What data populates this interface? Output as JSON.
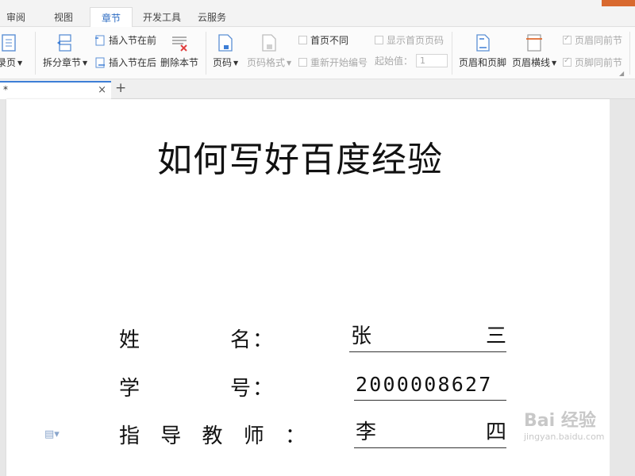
{
  "menubar": {
    "tabs": [
      "审阅",
      "视图",
      "章节",
      "开发工具",
      "云服务"
    ],
    "active_tab": "章节"
  },
  "ribbon": {
    "toc_page": "录页",
    "split_section": "拆分章节",
    "insert_before": "插入节在前",
    "insert_after": "插入节在后",
    "delete_section": "删除本节",
    "page_number": "页码",
    "page_number_format": "页码格式",
    "first_page_different": "首页不同",
    "restart_numbering": "重新开始编号",
    "show_first_page_number": "显示首页页码",
    "start_value_label": "起始值：",
    "start_value": "1",
    "header_footer": "页眉和页脚",
    "header_line": "页眉横线",
    "header_same_as_prev": "页眉同前节",
    "footer_same_as_prev": "页脚同前节"
  },
  "doc_tab": {
    "name": "*",
    "close": "×",
    "add": "+"
  },
  "document": {
    "title": "如何写好百度经验",
    "fields": [
      {
        "label": "姓　　　　名：",
        "value_left": "张",
        "value_right": "三"
      },
      {
        "label": "学　　　　号：",
        "value_left": "2000008627",
        "value_right": ""
      },
      {
        "label": "指 导 教 师 ：",
        "value_left": "李",
        "value_right": "四"
      }
    ]
  },
  "watermark": {
    "brand": "Bai 经验",
    "url": "jingyan.baidu.com"
  },
  "colors": {
    "accent": "#2a6ac2",
    "tab_underline": "#3d7ed6",
    "brand_bar": "#d8692f"
  }
}
